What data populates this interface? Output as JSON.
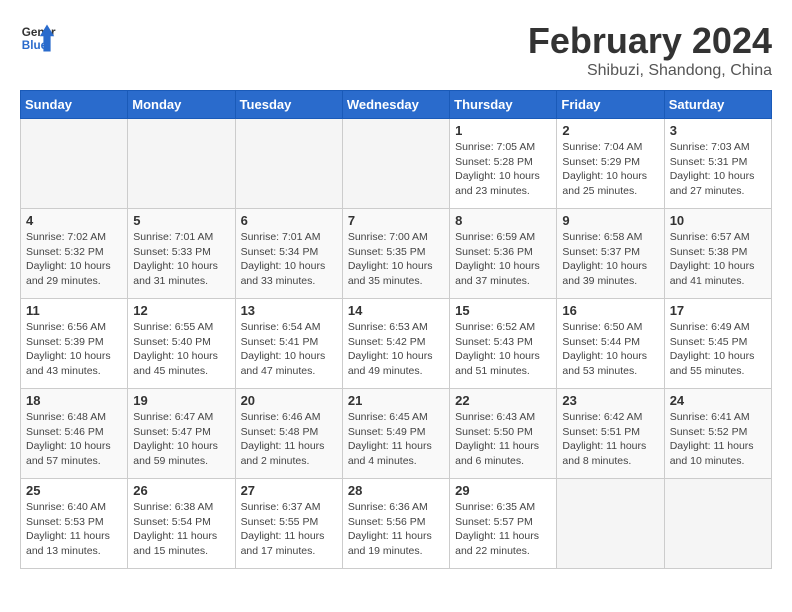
{
  "logo": {
    "line1": "General",
    "line2": "Blue"
  },
  "title": "February 2024",
  "subtitle": "Shibuzi, Shandong, China",
  "weekdays": [
    "Sunday",
    "Monday",
    "Tuesday",
    "Wednesday",
    "Thursday",
    "Friday",
    "Saturday"
  ],
  "weeks": [
    [
      {
        "day": "",
        "info": ""
      },
      {
        "day": "",
        "info": ""
      },
      {
        "day": "",
        "info": ""
      },
      {
        "day": "",
        "info": ""
      },
      {
        "day": "1",
        "info": "Sunrise: 7:05 AM\nSunset: 5:28 PM\nDaylight: 10 hours\nand 23 minutes."
      },
      {
        "day": "2",
        "info": "Sunrise: 7:04 AM\nSunset: 5:29 PM\nDaylight: 10 hours\nand 25 minutes."
      },
      {
        "day": "3",
        "info": "Sunrise: 7:03 AM\nSunset: 5:31 PM\nDaylight: 10 hours\nand 27 minutes."
      }
    ],
    [
      {
        "day": "4",
        "info": "Sunrise: 7:02 AM\nSunset: 5:32 PM\nDaylight: 10 hours\nand 29 minutes."
      },
      {
        "day": "5",
        "info": "Sunrise: 7:01 AM\nSunset: 5:33 PM\nDaylight: 10 hours\nand 31 minutes."
      },
      {
        "day": "6",
        "info": "Sunrise: 7:01 AM\nSunset: 5:34 PM\nDaylight: 10 hours\nand 33 minutes."
      },
      {
        "day": "7",
        "info": "Sunrise: 7:00 AM\nSunset: 5:35 PM\nDaylight: 10 hours\nand 35 minutes."
      },
      {
        "day": "8",
        "info": "Sunrise: 6:59 AM\nSunset: 5:36 PM\nDaylight: 10 hours\nand 37 minutes."
      },
      {
        "day": "9",
        "info": "Sunrise: 6:58 AM\nSunset: 5:37 PM\nDaylight: 10 hours\nand 39 minutes."
      },
      {
        "day": "10",
        "info": "Sunrise: 6:57 AM\nSunset: 5:38 PM\nDaylight: 10 hours\nand 41 minutes."
      }
    ],
    [
      {
        "day": "11",
        "info": "Sunrise: 6:56 AM\nSunset: 5:39 PM\nDaylight: 10 hours\nand 43 minutes."
      },
      {
        "day": "12",
        "info": "Sunrise: 6:55 AM\nSunset: 5:40 PM\nDaylight: 10 hours\nand 45 minutes."
      },
      {
        "day": "13",
        "info": "Sunrise: 6:54 AM\nSunset: 5:41 PM\nDaylight: 10 hours\nand 47 minutes."
      },
      {
        "day": "14",
        "info": "Sunrise: 6:53 AM\nSunset: 5:42 PM\nDaylight: 10 hours\nand 49 minutes."
      },
      {
        "day": "15",
        "info": "Sunrise: 6:52 AM\nSunset: 5:43 PM\nDaylight: 10 hours\nand 51 minutes."
      },
      {
        "day": "16",
        "info": "Sunrise: 6:50 AM\nSunset: 5:44 PM\nDaylight: 10 hours\nand 53 minutes."
      },
      {
        "day": "17",
        "info": "Sunrise: 6:49 AM\nSunset: 5:45 PM\nDaylight: 10 hours\nand 55 minutes."
      }
    ],
    [
      {
        "day": "18",
        "info": "Sunrise: 6:48 AM\nSunset: 5:46 PM\nDaylight: 10 hours\nand 57 minutes."
      },
      {
        "day": "19",
        "info": "Sunrise: 6:47 AM\nSunset: 5:47 PM\nDaylight: 10 hours\nand 59 minutes."
      },
      {
        "day": "20",
        "info": "Sunrise: 6:46 AM\nSunset: 5:48 PM\nDaylight: 11 hours\nand 2 minutes."
      },
      {
        "day": "21",
        "info": "Sunrise: 6:45 AM\nSunset: 5:49 PM\nDaylight: 11 hours\nand 4 minutes."
      },
      {
        "day": "22",
        "info": "Sunrise: 6:43 AM\nSunset: 5:50 PM\nDaylight: 11 hours\nand 6 minutes."
      },
      {
        "day": "23",
        "info": "Sunrise: 6:42 AM\nSunset: 5:51 PM\nDaylight: 11 hours\nand 8 minutes."
      },
      {
        "day": "24",
        "info": "Sunrise: 6:41 AM\nSunset: 5:52 PM\nDaylight: 11 hours\nand 10 minutes."
      }
    ],
    [
      {
        "day": "25",
        "info": "Sunrise: 6:40 AM\nSunset: 5:53 PM\nDaylight: 11 hours\nand 13 minutes."
      },
      {
        "day": "26",
        "info": "Sunrise: 6:38 AM\nSunset: 5:54 PM\nDaylight: 11 hours\nand 15 minutes."
      },
      {
        "day": "27",
        "info": "Sunrise: 6:37 AM\nSunset: 5:55 PM\nDaylight: 11 hours\nand 17 minutes."
      },
      {
        "day": "28",
        "info": "Sunrise: 6:36 AM\nSunset: 5:56 PM\nDaylight: 11 hours\nand 19 minutes."
      },
      {
        "day": "29",
        "info": "Sunrise: 6:35 AM\nSunset: 5:57 PM\nDaylight: 11 hours\nand 22 minutes."
      },
      {
        "day": "",
        "info": ""
      },
      {
        "day": "",
        "info": ""
      }
    ]
  ]
}
